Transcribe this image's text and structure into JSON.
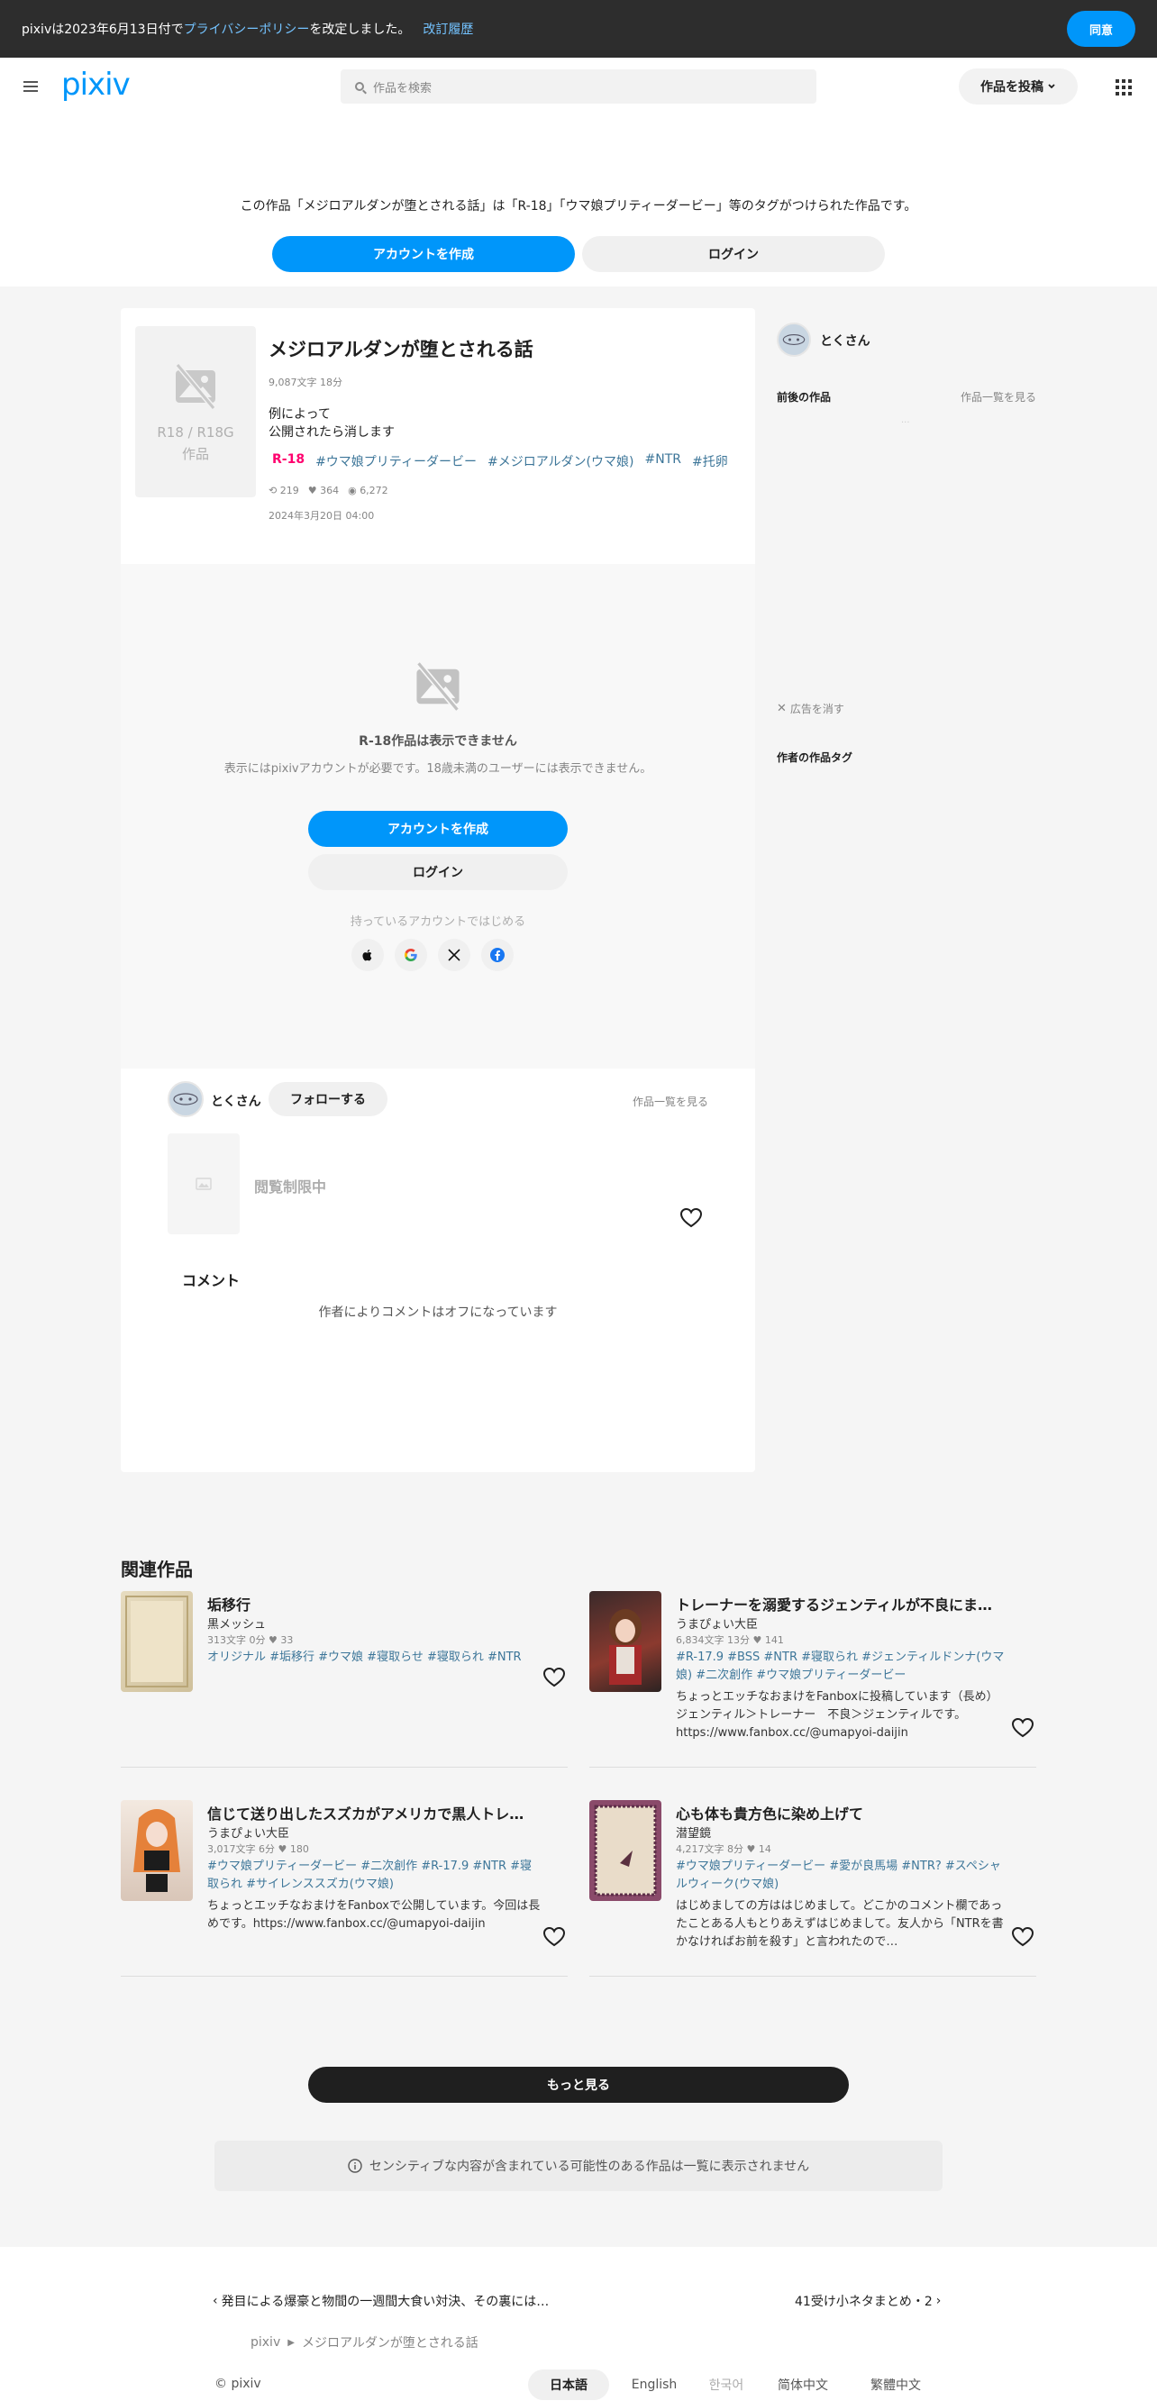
{
  "banner": {
    "prefix": "pixivは2023年6月13日付で",
    "policy_link": "プライバシーポリシー",
    "suffix": "を改定しました。",
    "history_link": "改訂履歴",
    "agree_label": "同意"
  },
  "header": {
    "logo": "pixiv",
    "search_placeholder": "作品を検索",
    "post_label": "作品を投稿"
  },
  "notice": {
    "text": "この作品「メジロアルダンが堕とされる話」は「R-18」「ウマ娘プリティーダービー」等のタグがつけられた作品です。",
    "create_account": "アカウントを作成",
    "login": "ログイン"
  },
  "work": {
    "thumb_label_1": "R18 / R18G",
    "thumb_label_2": "作品",
    "title": "メジロアルダンが堕とされる話",
    "meta": "9,087文字 18分",
    "desc_line1": "例によって",
    "desc_line2": "公開されたら消します",
    "tags": [
      "R-18",
      "#ウマ娘プリティーダービー",
      "#メジロアルダン(ウマ娘)",
      "#NTR",
      "#托卵"
    ],
    "reposts": "219",
    "likes": "364",
    "views": "6,272",
    "date": "2024年3月20日 04:00"
  },
  "restricted": {
    "title": "R-18作品は表示できません",
    "subtitle": "表示にはpixivアカウントが必要です。18歳未満のユーザーには表示できません。",
    "create_account": "アカウントを作成",
    "login": "ログイン",
    "sso_text": "持っているアカウントではじめる"
  },
  "author": {
    "name": "とくさん",
    "follow": "フォローする",
    "works_link": "作品一覧を見る",
    "restricted_label": "閲覧制限中"
  },
  "comments": {
    "title": "コメント",
    "off_text": "作者によりコメントはオフになっています"
  },
  "side": {
    "author_name": "とくさん",
    "prev_next": "前後の作品",
    "works_link": "作品一覧を見る",
    "hide_ads": "広告を消す",
    "author_tags": "作者の作品タグ"
  },
  "related": {
    "title": "関連作品",
    "items": [
      {
        "title": "垢移行",
        "author": "黒メッシュ",
        "meta": "313文字 0分 ♥ 33",
        "tags": "オリジナル #垢移行 #ウマ娘 #寝取らせ #寝取られ #NTR",
        "desc": ""
      },
      {
        "title": "トレーナーを溺愛するジェンティルが不良にま…",
        "author": "うまぴょい大臣",
        "meta": "6,834文字 13分 ♥ 141",
        "tags": "#R-17.9 #BSS #NTR #寝取られ #ジェンティルドンナ(ウマ娘) #二次創作 #ウマ娘プリティーダービー",
        "desc": "ちょっとエッチなおまけをFanboxに投稿しています（長め）ジェンティル＞トレーナー　不良＞ジェンティルです。https://www.fanbox.cc/@umapyoi-daijin"
      },
      {
        "title": "信じて送り出したスズカがアメリカで黒人トレ…",
        "author": "うまぴょい大臣",
        "meta": "3,017文字 6分 ♥ 180",
        "tags": "#ウマ娘プリティーダービー #二次創作 #R-17.9 #NTR #寝取られ #サイレンススズカ(ウマ娘)",
        "desc": "ちょっとエッチなおまけをFanboxで公開しています。今回は長めです。https://www.fanbox.cc/@umapyoi-daijin"
      },
      {
        "title": "心も体も貴方色に染め上げて",
        "author": "潜望鏡",
        "meta": "4,217文字 8分 ♥ 14",
        "tags": "#ウマ娘プリティーダービー #愛が良馬場 #NTR? #スペシャルウィーク(ウマ娘)",
        "desc": "はじめましての方ははじめまして。どこかのコメント欄であったことある人もとりあえずはじめまして。友人から「NTRを書かなければお前を殺す」と言われたので…"
      }
    ],
    "more": "もっと見る",
    "sensitive": "センシティブな内容が含まれている可能性のある作品は一覧に表示されません"
  },
  "footer": {
    "prev_work": "発目による爆豪と物間の一週間大食い対決、その裏には…",
    "next_work": "41受け小ネタまとめ・2",
    "crumb_root": "pixiv",
    "crumb_current": "メジロアルダンが堕とされる話",
    "copyright": "© pixiv",
    "languages": [
      "日本語",
      "English",
      "한국어",
      "简体中文",
      "繁體中文"
    ]
  }
}
